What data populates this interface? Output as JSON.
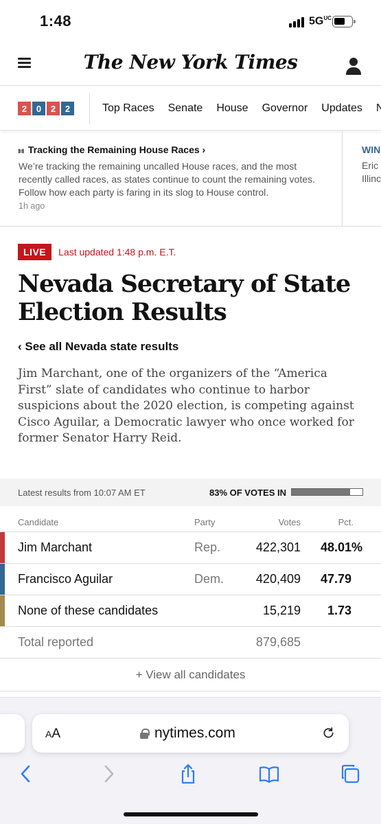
{
  "status_bar": {
    "time": "1:48",
    "network": "5G",
    "network_suffix": "UC"
  },
  "header": {
    "masthead": "The New York Times"
  },
  "election_nav": {
    "year_digits": [
      "2",
      "0",
      "2",
      "2"
    ],
    "year_colors": [
      "#d9534f",
      "#326891",
      "#d9534f",
      "#326891"
    ],
    "links": [
      "Top Races",
      "Senate",
      "House",
      "Governor",
      "Updates",
      "Ne"
    ]
  },
  "ticker": {
    "title": "Tracking the Remaining House Races ›",
    "text": "We’re tracking the remaining uncalled House races, and the most recently called races, as states continue to count the remaining votes. Follow how each party is faring in its slog to House control.",
    "time": "1h ago",
    "next_title": "WIN",
    "next_lines": [
      "Eric",
      "Illinc"
    ]
  },
  "article": {
    "live_label": "LIVE",
    "updated": "Last updated 1:48 p.m. E.T.",
    "headline": "Nevada Secretary of State Election Results",
    "back_link": "‹ See all Nevada state results",
    "summary": "Jim Marchant, one of the organizers of the “America First” slate of candidates who continue to harbor suspicions about the 2020 election, is competing against Cisco Aguilar, a Democratic lawyer who once worked for former Senator Harry Reid."
  },
  "results": {
    "latest": "Latest results from 10:07 AM ET",
    "votes_in": "83% OF VOTES IN",
    "votes_in_fraction": 0.83,
    "columns": {
      "candidate": "Candidate",
      "party": "Party",
      "votes": "Votes",
      "pct": "Pct."
    },
    "rows": [
      {
        "name": "Jim Marchant",
        "party": "Rep.",
        "votes": "422,301",
        "pct": "48.01%",
        "color": "#c0393b"
      },
      {
        "name": "Francisco Aguilar",
        "party": "Dem.",
        "votes": "420,409",
        "pct": "47.79",
        "color": "#326891"
      },
      {
        "name": "None of these candidates",
        "party": "",
        "votes": "15,219",
        "pct": "1.73",
        "color": "#a38a4e"
      }
    ],
    "total_label": "Total reported",
    "total_votes": "879,685",
    "view_all": "+ View all candidates"
  },
  "browser": {
    "text_size_label_small": "A",
    "text_size_label_large": "A",
    "url": "nytimes.com"
  },
  "icons": [
    "hamburger-icon",
    "account-icon",
    "pin-icon",
    "lock-icon",
    "reload-icon",
    "back-icon",
    "forward-icon",
    "share-icon",
    "bookmarks-icon",
    "tabs-icon"
  ]
}
